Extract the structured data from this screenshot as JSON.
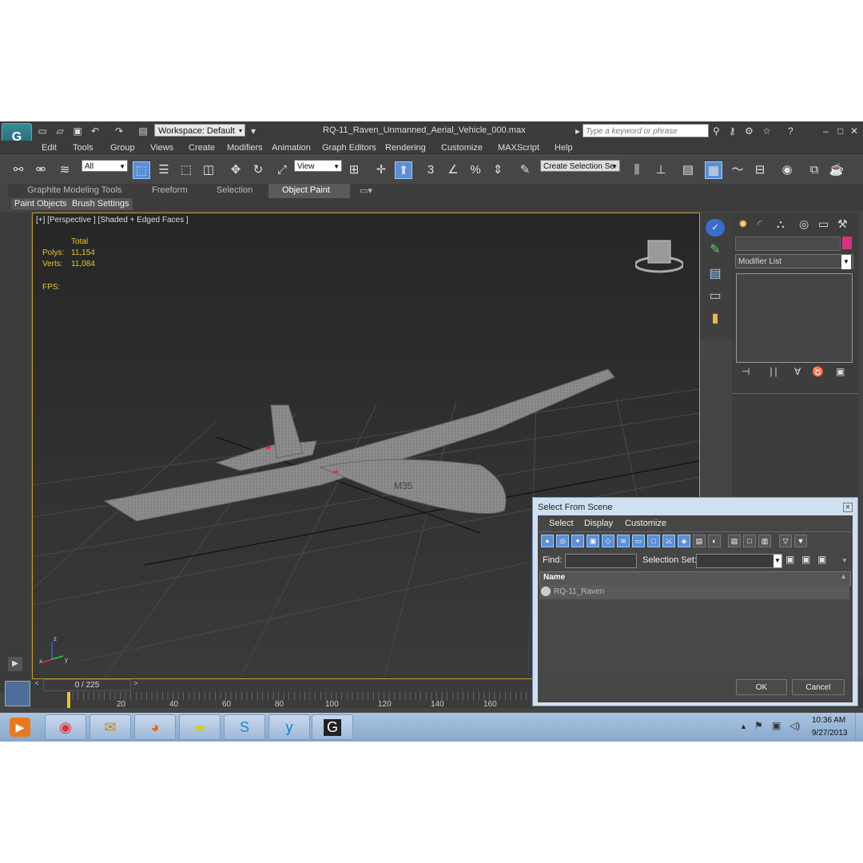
{
  "window": {
    "title": "RQ-11_Raven_Unmanned_Aerial_Vehicle_000.max",
    "workspace": "Workspace: Default",
    "search_placeholder": "Type a keyword or phrase",
    "app_icon": "3ds-max-logo-icon"
  },
  "menubar": [
    "Edit",
    "Tools",
    "Group",
    "Views",
    "Create",
    "Modifiers",
    "Animation",
    "Graph Editors",
    "Rendering",
    "Customize",
    "MAXScript",
    "Help"
  ],
  "toolbar": {
    "selection_filter": "All",
    "reference_coord": "View",
    "snap_labels": [
      "3",
      "%"
    ],
    "named_selection_placeholder": "Create Selection Se"
  },
  "ribbon": {
    "tabs": [
      "Graphite Modeling Tools",
      "Freeform",
      "Selection",
      "Object Paint"
    ],
    "active_tab": "Object Paint",
    "subtabs": [
      "Paint Objects",
      "Brush Settings"
    ]
  },
  "viewport": {
    "label": "[+] [Perspective ] [Shaded + Edged Faces ]",
    "stats_header": "Total",
    "polys_label": "Polys:",
    "polys_value": "11,154",
    "verts_label": "Verts:",
    "verts_value": "11,084",
    "fps_label": "FPS:",
    "axis_labels": [
      "z",
      "x",
      "y"
    ],
    "aircraft_markings": "M35"
  },
  "command_panel": {
    "modifier_list": "Modifier List",
    "color_swatch": "#d63384"
  },
  "timeline": {
    "frame_counter": "0 / 225",
    "ticks": [
      "20",
      "40",
      "60",
      "80",
      "100",
      "120",
      "140",
      "160"
    ]
  },
  "dialog": {
    "title": "Select From Scene",
    "menus": [
      "Select",
      "Display",
      "Customize"
    ],
    "find_label": "Find:",
    "selection_set_label": "Selection Set:",
    "column_header": "Name",
    "items": [
      "RQ-11_Raven"
    ],
    "ok_label": "OK",
    "cancel_label": "Cancel"
  },
  "taskbar": {
    "apps": [
      "media-player-icon",
      "chrome-icon",
      "outlook-icon",
      "firefox-icon",
      "sticky-notes-icon",
      "skype-icon",
      "yammer-icon",
      "3ds-max-icon"
    ],
    "time": "10:36 AM",
    "date": "9/27/2013"
  },
  "colors": {
    "viewport_border": "#c7a12c",
    "stats_text": "#e6c62e",
    "active_button": "#5a8fd6",
    "taskbar": "#a9c4e0"
  }
}
